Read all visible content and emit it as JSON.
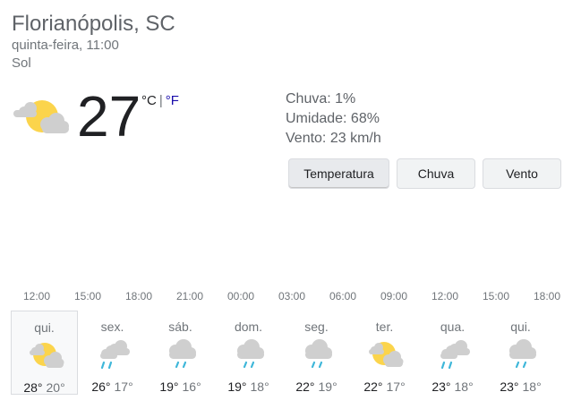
{
  "location": "Florianópolis, SC",
  "datetime": "quinta-feira, 11:00",
  "condition": "Sol",
  "current": {
    "temp": "27",
    "unit_c": "°C",
    "unit_sep": "|",
    "unit_f": "°F",
    "icon": "sun-cloud-icon"
  },
  "details": {
    "rain": "Chuva: 1%",
    "humidity": "Umidade: 68%",
    "wind": "Vento: 23 km/h"
  },
  "tabs": [
    {
      "label": "Temperatura",
      "active": true
    },
    {
      "label": "Chuva",
      "active": false
    },
    {
      "label": "Vento",
      "active": false
    }
  ],
  "hours": [
    "12:00",
    "15:00",
    "18:00",
    "21:00",
    "00:00",
    "03:00",
    "06:00",
    "09:00",
    "12:00",
    "15:00",
    "18:00"
  ],
  "forecast": [
    {
      "day": "qui.",
      "icon": "sun-cloud-icon",
      "high": "28°",
      "low": "20°",
      "selected": true
    },
    {
      "day": "sex.",
      "icon": "cloud-rain-partly-icon",
      "high": "26°",
      "low": "17°"
    },
    {
      "day": "sáb.",
      "icon": "cloud-rain-icon",
      "high": "19°",
      "low": "16°"
    },
    {
      "day": "dom.",
      "icon": "cloud-rain-icon",
      "high": "19°",
      "low": "18°"
    },
    {
      "day": "seg.",
      "icon": "cloud-rain-icon",
      "high": "22°",
      "low": "19°"
    },
    {
      "day": "ter.",
      "icon": "sun-cloud-icon",
      "high": "22°",
      "low": "17°"
    },
    {
      "day": "qua.",
      "icon": "cloud-rain-partly-icon",
      "high": "23°",
      "low": "18°"
    },
    {
      "day": "qui.",
      "icon": "cloud-rain-icon",
      "high": "23°",
      "low": "18°"
    }
  ],
  "colors": {
    "sun": "#fbd44c",
    "cloud": "#cfcfcf",
    "rain": "#3fb7d9"
  }
}
